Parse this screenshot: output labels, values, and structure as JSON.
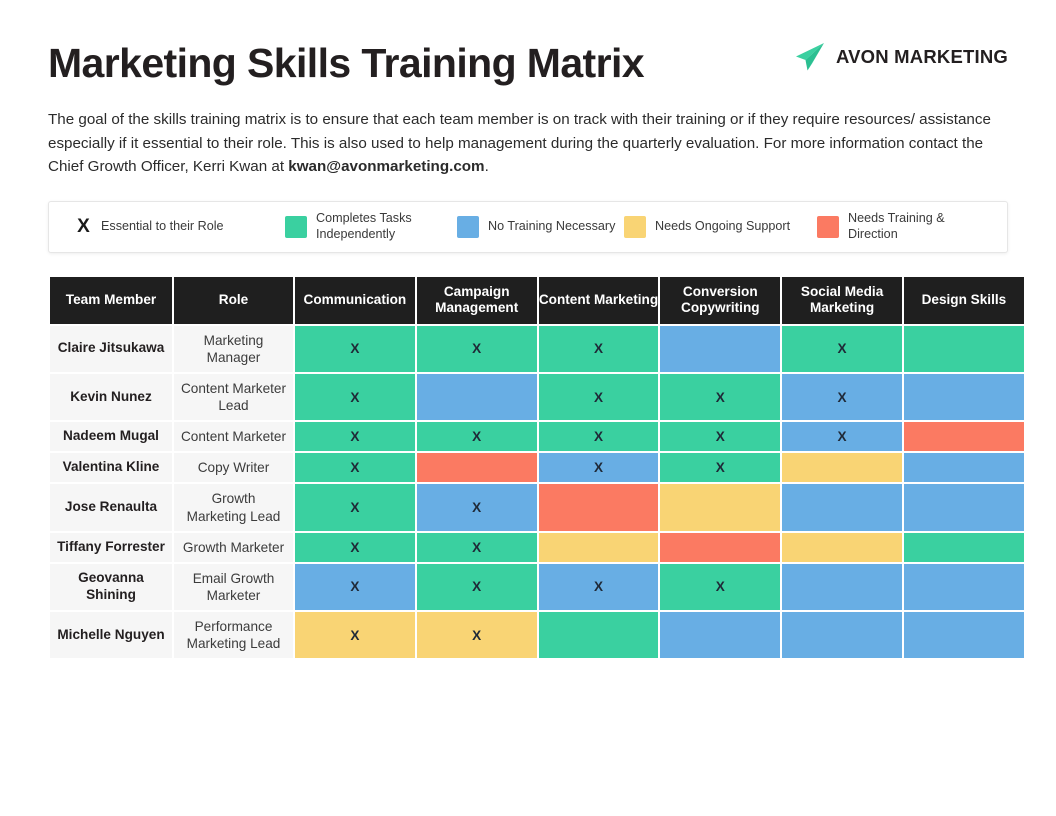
{
  "header": {
    "title": "Marketing Skills Training Matrix",
    "brand_icon": "paper-plane-icon",
    "brand_name": "AVON MARKETING",
    "brand_color": "#3ad0a0"
  },
  "description": {
    "part1": "The goal of the skills training matrix is to ensure that each team member is on track with their training or if they require resources/ assistance especially if it essential to their role. This is also used to help management during the quarterly evaluation. For more information contact the Chief Growth Officer, Kerri Kwan at ",
    "email": "kwan@avonmarketing.com",
    "part2": "."
  },
  "legend": {
    "items": [
      {
        "symbol": "X",
        "label": "Essential to their Role",
        "color": null
      },
      {
        "symbol": null,
        "label": "Completes Tasks Independently",
        "color": "#3ad0a0"
      },
      {
        "symbol": null,
        "label": "No Training Necessary",
        "color": "#68aee4"
      },
      {
        "symbol": null,
        "label": "Needs Ongoing Support",
        "color": "#f9d474"
      },
      {
        "symbol": null,
        "label": "Needs Training & Direction",
        "color": "#fb7a62"
      }
    ]
  },
  "matrix": {
    "columns": [
      "Team Member",
      "Role",
      "Communication",
      "Campaign Management",
      "Content Marketing",
      "Conversion Copywriting",
      "Social Media Marketing",
      "Design Skills"
    ],
    "mark": "X",
    "rows": [
      {
        "member": "Claire Jitsukawa",
        "role": "Marketing Manager",
        "cells": [
          {
            "status": "green",
            "mark": "X"
          },
          {
            "status": "green",
            "mark": "X"
          },
          {
            "status": "green",
            "mark": "X"
          },
          {
            "status": "blue",
            "mark": ""
          },
          {
            "status": "green",
            "mark": "X"
          },
          {
            "status": "green",
            "mark": ""
          }
        ]
      },
      {
        "member": "Kevin Nunez",
        "role": "Content Marketer Lead",
        "cells": [
          {
            "status": "green",
            "mark": "X"
          },
          {
            "status": "blue",
            "mark": ""
          },
          {
            "status": "green",
            "mark": "X"
          },
          {
            "status": "green",
            "mark": "X"
          },
          {
            "status": "blue",
            "mark": "X"
          },
          {
            "status": "blue",
            "mark": ""
          }
        ]
      },
      {
        "member": "Nadeem Mugal",
        "role": "Content Marketer",
        "cells": [
          {
            "status": "green",
            "mark": "X"
          },
          {
            "status": "green",
            "mark": "X"
          },
          {
            "status": "green",
            "mark": "X"
          },
          {
            "status": "green",
            "mark": "X"
          },
          {
            "status": "blue",
            "mark": "X"
          },
          {
            "status": "red",
            "mark": ""
          }
        ]
      },
      {
        "member": "Valentina Kline",
        "role": "Copy Writer",
        "cells": [
          {
            "status": "green",
            "mark": "X"
          },
          {
            "status": "red",
            "mark": ""
          },
          {
            "status": "blue",
            "mark": "X"
          },
          {
            "status": "green",
            "mark": "X"
          },
          {
            "status": "yellow",
            "mark": ""
          },
          {
            "status": "blue",
            "mark": ""
          }
        ]
      },
      {
        "member": "Jose Renaulta",
        "role": "Growth Marketing Lead",
        "cells": [
          {
            "status": "green",
            "mark": "X"
          },
          {
            "status": "blue",
            "mark": "X"
          },
          {
            "status": "red",
            "mark": ""
          },
          {
            "status": "yellow",
            "mark": ""
          },
          {
            "status": "blue",
            "mark": ""
          },
          {
            "status": "blue",
            "mark": ""
          }
        ]
      },
      {
        "member": "Tiffany Forrester",
        "role": "Growth Marketer",
        "cells": [
          {
            "status": "green",
            "mark": "X"
          },
          {
            "status": "green",
            "mark": "X"
          },
          {
            "status": "yellow",
            "mark": ""
          },
          {
            "status": "red",
            "mark": ""
          },
          {
            "status": "yellow",
            "mark": ""
          },
          {
            "status": "green",
            "mark": ""
          }
        ]
      },
      {
        "member": "Geovanna Shining",
        "role": "Email Growth Marketer",
        "cells": [
          {
            "status": "blue",
            "mark": "X"
          },
          {
            "status": "green",
            "mark": "X"
          },
          {
            "status": "blue",
            "mark": "X"
          },
          {
            "status": "green",
            "mark": "X"
          },
          {
            "status": "blue",
            "mark": ""
          },
          {
            "status": "blue",
            "mark": ""
          }
        ]
      },
      {
        "member": "Michelle Nguyen",
        "role": "Performance Marketing Lead",
        "cells": [
          {
            "status": "yellow",
            "mark": "X"
          },
          {
            "status": "yellow",
            "mark": "X"
          },
          {
            "status": "green",
            "mark": ""
          },
          {
            "status": "blue",
            "mark": ""
          },
          {
            "status": "blue",
            "mark": ""
          },
          {
            "status": "blue",
            "mark": ""
          }
        ]
      }
    ]
  }
}
